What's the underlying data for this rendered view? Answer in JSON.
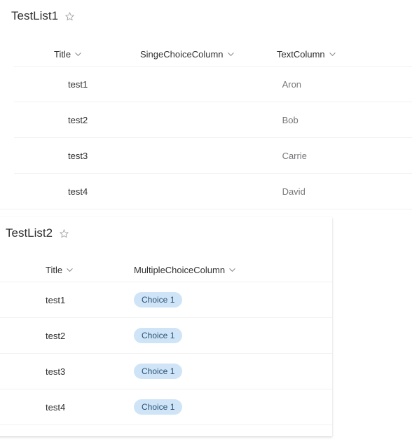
{
  "list1": {
    "title": "TestList1",
    "favorite_icon": "star-outline-icon",
    "columns": [
      {
        "label": "Title",
        "sort_icon": "chevron-down-icon"
      },
      {
        "label": "SingeChoiceColumn",
        "sort_icon": "chevron-down-icon"
      },
      {
        "label": "TextColumn",
        "sort_icon": "chevron-down-icon"
      }
    ],
    "rows": [
      {
        "title": "test1",
        "singe_choice": "",
        "text": "Aron"
      },
      {
        "title": "test2",
        "singe_choice": "",
        "text": "Bob"
      },
      {
        "title": "test3",
        "singe_choice": "",
        "text": "Carrie"
      },
      {
        "title": "test4",
        "singe_choice": "",
        "text": "David"
      }
    ]
  },
  "list2": {
    "title": "TestList2",
    "favorite_icon": "star-outline-icon",
    "columns": [
      {
        "label": "Title",
        "sort_icon": "chevron-down-icon"
      },
      {
        "label": "MultipleChoiceColumn",
        "sort_icon": "chevron-down-icon"
      }
    ],
    "rows": [
      {
        "title": "test1",
        "choices": "Choice 1"
      },
      {
        "title": "test2",
        "choices": "Choice 1"
      },
      {
        "title": "test3",
        "choices": "Choice 1"
      },
      {
        "title": "test4",
        "choices": "Choice 1"
      }
    ]
  },
  "colors": {
    "page_background": "#ffffff",
    "text_primary": "#323130",
    "text_secondary": "#77767a",
    "divider": "#f1f1f1",
    "pill_background": "#cfe4f7",
    "pill_text": "#2b5374",
    "icon": "#a19f9d"
  }
}
